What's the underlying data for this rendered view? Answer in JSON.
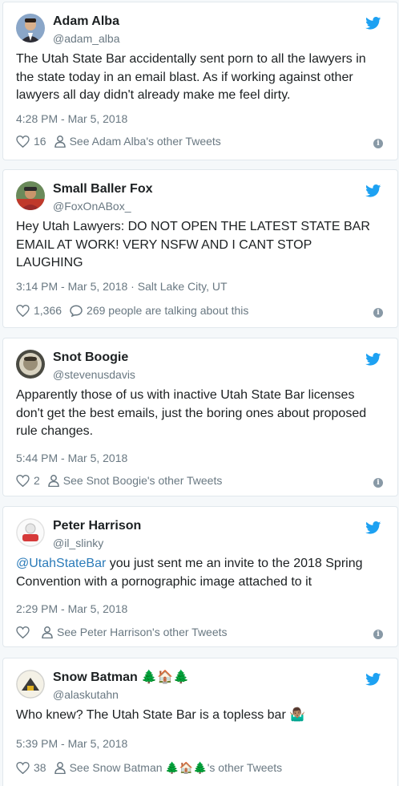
{
  "colors": {
    "accent": "#1da1f2",
    "link": "#2b7bb9",
    "muted": "#697882",
    "text": "#1c2022"
  },
  "tweets": [
    {
      "name": "Adam Alba",
      "emoji": "",
      "handle": "@adam_alba",
      "mention": "",
      "text_lines": [
        "The Utah State Bar accidentally sent porn to all the lawyers in",
        "the state today in an email blast. As if working against other",
        "lawyers all day didn't already make me feel dirty."
      ],
      "timestamp": "4:28 PM - Mar 5, 2018",
      "likes": "16",
      "secondary": "See Adam Alba's other Tweets",
      "secondary_icon": "person-icon"
    },
    {
      "name": "Small Baller Fox",
      "emoji": "",
      "handle": "@FoxOnABox_",
      "mention": "",
      "text_lines": [
        "Hey Utah Lawyers: DO NOT OPEN THE LATEST STATE BAR",
        "EMAIL AT WORK! VERY NSFW AND I CANT STOP",
        "LAUGHING"
      ],
      "timestamp": "3:14 PM - Mar 5, 2018 · Salt Lake City, UT",
      "likes": "1,366",
      "secondary": "269 people are talking about this",
      "secondary_icon": "speech-bubble-icon"
    },
    {
      "name": "Snot Boogie",
      "emoji": "",
      "handle": "@stevenusdavis",
      "mention": "",
      "text_lines": [
        "Apparently those of us with inactive Utah State Bar licenses",
        "don't get the best emails, just the boring ones about proposed",
        "rule changes."
      ],
      "timestamp": "5:44 PM - Mar 5, 2018",
      "likes": "2",
      "secondary": "See Snot Boogie's other Tweets",
      "secondary_icon": "person-icon"
    },
    {
      "name": "Peter Harrison",
      "emoji": "",
      "handle": "@il_slinky",
      "mention": "@UtahStateBar",
      "text_lines": [
        " you just sent me an invite to the 2018 Spring",
        "Convention with a pornographic image attached to it"
      ],
      "timestamp": "2:29 PM - Mar 5, 2018",
      "likes": "",
      "secondary": "See Peter Harrison's other Tweets",
      "secondary_icon": "person-icon"
    },
    {
      "name": "Snow Batman",
      "emoji": "🌲🏠🌲",
      "handle": "@alaskutahn",
      "mention": "",
      "text_lines": [
        "Who knew? The Utah State Bar is a topless bar 🤷🏽‍♂️"
      ],
      "timestamp": "5:39 PM - Mar 5, 2018",
      "likes": "38",
      "secondary": "See Snow Batman 🌲🏠🌲's other Tweets",
      "secondary_icon": "person-icon"
    }
  ]
}
